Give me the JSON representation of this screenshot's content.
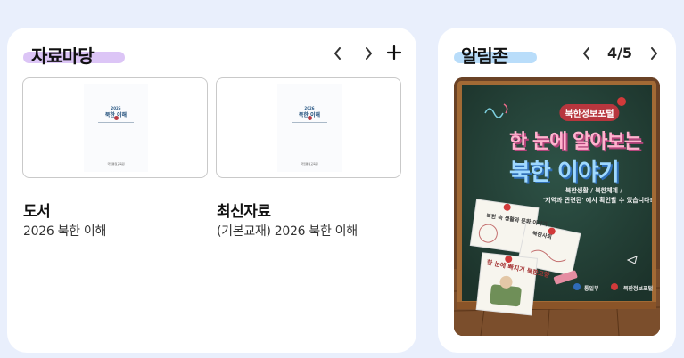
{
  "library": {
    "title": "자료마당",
    "items": [
      {
        "category": "도서",
        "name": "2026 북한 이해",
        "thumb_year": "2026",
        "thumb_title": "북한 이해",
        "thumb_footer": "국립통일교육원"
      },
      {
        "category": "최신자료",
        "name": "(기본교재) 2026 북한 이해",
        "thumb_year": "2026",
        "thumb_title": "북한 이해",
        "thumb_footer": "국립통일교육원"
      }
    ],
    "prev_icon": "chevron-left-icon",
    "next_icon": "chevron-right-icon",
    "more_icon": "plus-icon"
  },
  "notice": {
    "title": "알림존",
    "page_current": "4",
    "page_separator": "/",
    "page_total": "5",
    "banner": {
      "badge": "북한정보포털",
      "line1": "한 눈에 알아보는",
      "line2": "북한 이야기",
      "desc1": "북한생활 / 북한체제 /",
      "desc2": "'지역과 관련된' 에서 확인할 수 있습니다!",
      "note1": "북한 속 생활과 문화 이야기",
      "note2": "북한사회",
      "note3": "한 눈에 빠지기 북한고향",
      "footer1": "통일부",
      "footer2": "북한정보포털"
    },
    "prev_icon": "chevron-left-icon",
    "next_icon": "chevron-right-icon"
  },
  "colors": {
    "page_bg": "#e9effc",
    "library_highlight": "#dcc5f6",
    "notice_highlight": "#b9ddfa",
    "chalkboard": "#25443a",
    "frame_wood": "#a26a35"
  }
}
